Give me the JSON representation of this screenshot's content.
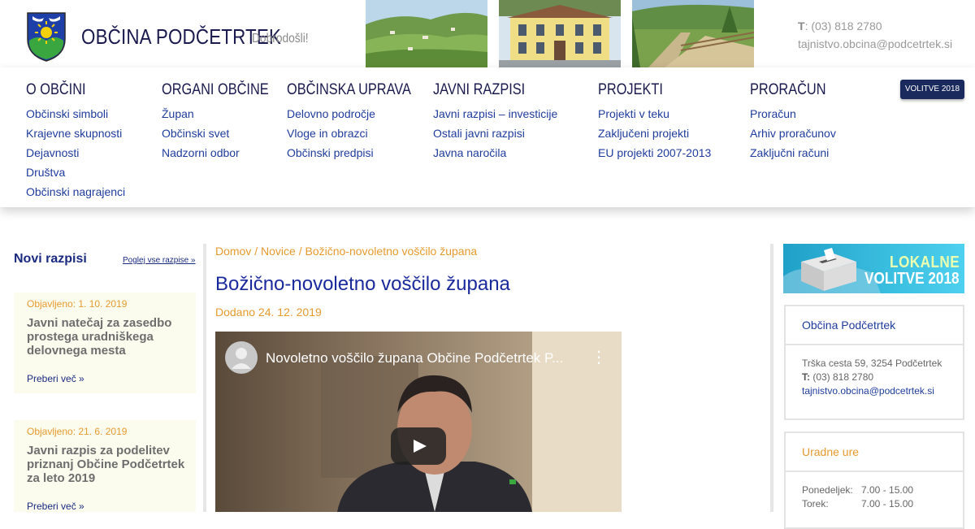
{
  "header": {
    "site_name": "OBČINA PODČETRTEK",
    "welcome": "Dobrodošli!",
    "phone_label": "T",
    "phone": ": (03) 818 2780",
    "email": "tajnistvo.obcina@podcetrtek.si"
  },
  "nav": {
    "columns": [
      {
        "heading": "O OBČINI",
        "links": [
          "Občinski simboli",
          "Krajevne skupnosti",
          "Dejavnosti",
          "Društva",
          "Občinski nagrajenci"
        ]
      },
      {
        "heading": "ORGANI OBČINE",
        "links": [
          "Župan",
          "Občinski svet",
          "Nadzorni odbor"
        ]
      },
      {
        "heading": "OBČINSKA UPRAVA",
        "links": [
          "Delovno področje",
          "Vloge in obrazci",
          "Občinski predpisi"
        ]
      },
      {
        "heading": "JAVNI RAZPISI",
        "links": [
          "Javni razpisi – investicije",
          "Ostali javni razpisi",
          "Javna naročila"
        ]
      },
      {
        "heading": "PROJEKTI",
        "links": [
          "Projekti v teku",
          "Zaključeni projekti",
          "EU projekti 2007-2013"
        ]
      },
      {
        "heading": "PRORAČUN",
        "links": [
          "Proračun",
          "Arhiv proračunov",
          "Zaključni računi"
        ]
      }
    ],
    "volitve_badge": "VOLITVE 2018"
  },
  "sidebar_left": {
    "title": "Novi razpisi",
    "all_link": "Poglej vse razpise »",
    "tenders": [
      {
        "published": "Objavljeno: 1. 10. 2019",
        "title": "Javni natečaj za zasedbo prostega uradniškega delovnega mesta",
        "more": "Preberi več »"
      },
      {
        "published": "Objavljeno: 21. 6. 2019",
        "title": "Javni razpis za podelitev priznanj Občine Podčetrtek za leto 2019",
        "more": "Preberi več »"
      }
    ]
  },
  "main": {
    "breadcrumb": "Domov / Novice / Božično-novoletno voščilo župana",
    "title": "Božično-novoletno voščilo župana",
    "added": "Dodano 24. 12. 2019",
    "video_title": "Novoletno voščilo župana Občine Podčetrtek P..."
  },
  "sidebar_right": {
    "banner_line1": "LOKALNE",
    "banner_line2": "VOLITVE 2018",
    "office_box": {
      "title": "Občina Podčetrtek",
      "address": "Trška cesta 59, 3254 Podčetrtek",
      "phone_label": "T:",
      "phone": " (03) 818 2780",
      "email": "tajnistvo.obcina@podcetrtek.si"
    },
    "hours_box": {
      "title": "Uradne ure",
      "rows": [
        {
          "day": "Ponedeljek:",
          "time": "7.00 - 15.00"
        },
        {
          "day": "Torek:",
          "time": "7.00 - 15.00"
        }
      ]
    }
  },
  "colors": {
    "brand_navy": "#1a1a4e",
    "link_blue": "#1f3c9c",
    "accent_orange": "#e69a2e",
    "tender_bg": "#fbfcee"
  }
}
